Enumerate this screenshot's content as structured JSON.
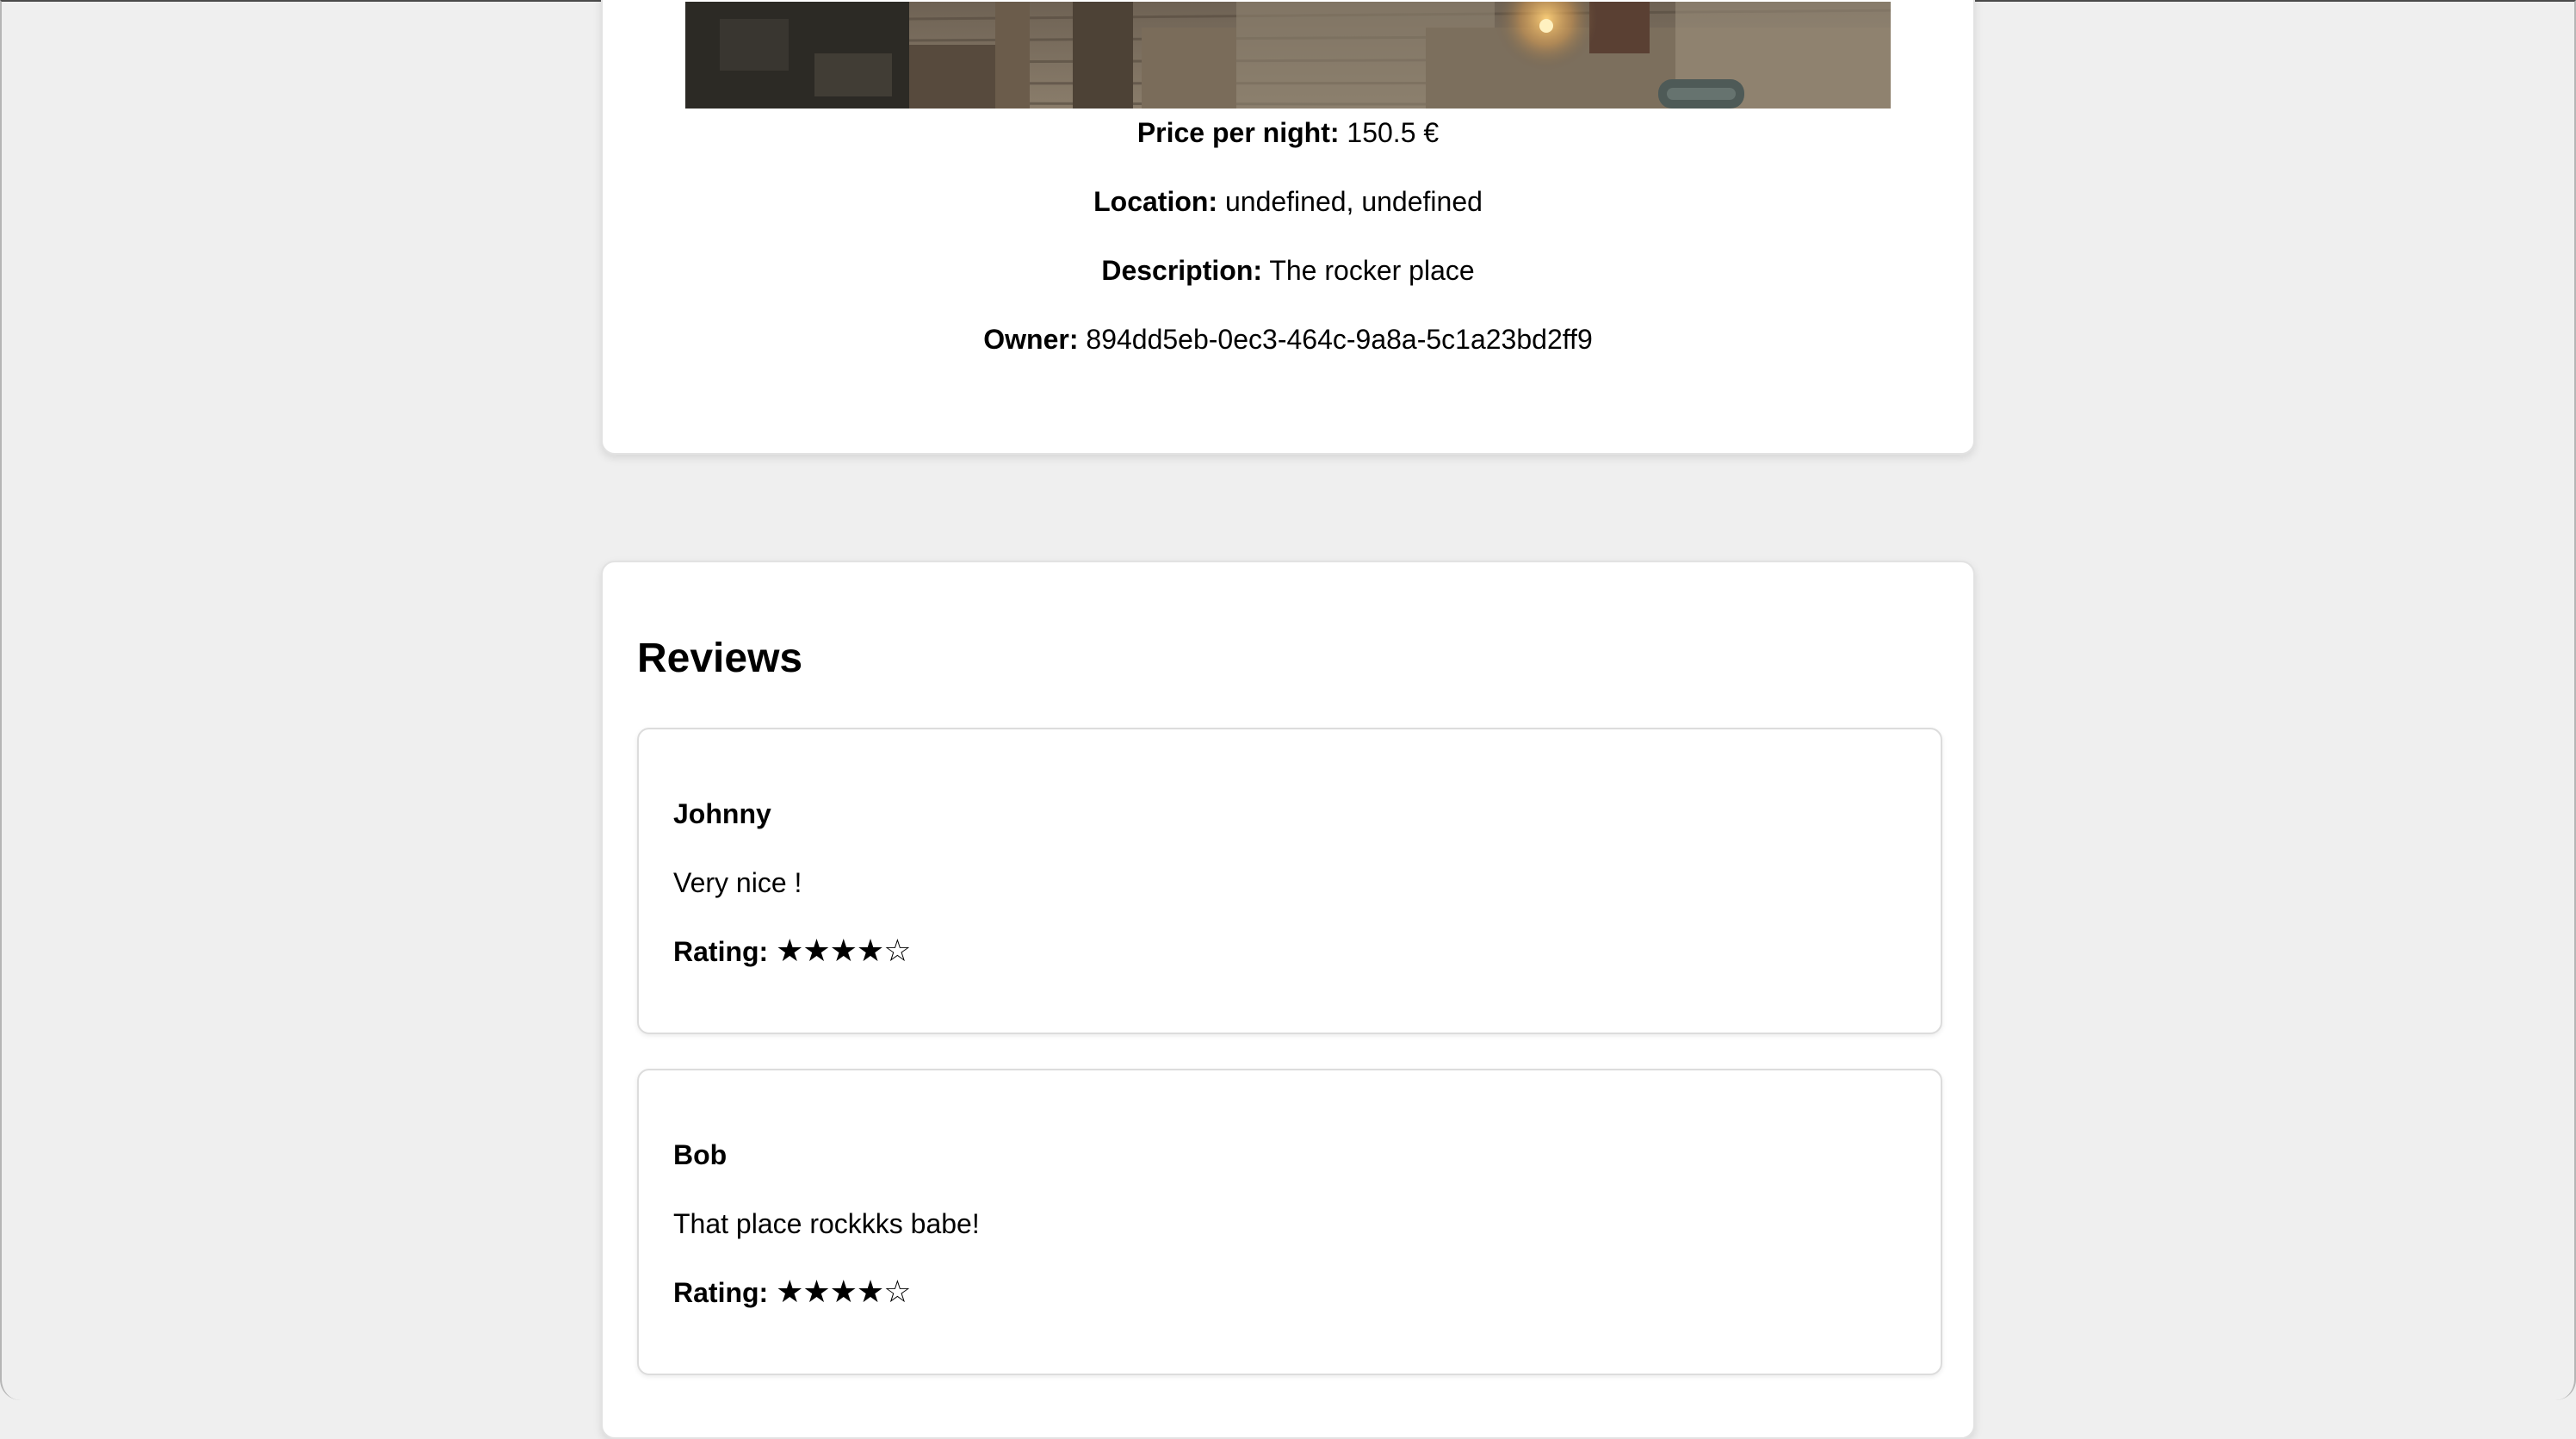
{
  "listing": {
    "photo_icon": "listing-photo",
    "price_label": "Price per night:",
    "price_value": "150.5 €",
    "location_label": "Location:",
    "location_value": "undefined, undefined",
    "description_label": "Description:",
    "description_value": "The rocker place",
    "owner_label": "Owner:",
    "owner_value": "894dd5eb-0ec3-464c-9a8a-5c1a23bd2ff9"
  },
  "reviews": {
    "heading": "Reviews",
    "rating_label": "Rating:",
    "items": [
      {
        "author": "Johnny",
        "text": "Very nice !",
        "rating": 4,
        "max_rating": 5,
        "stars": "★★★★☆"
      },
      {
        "author": "Bob",
        "text": "That place rockkks babe!",
        "rating": 4,
        "max_rating": 5,
        "stars": "★★★★☆"
      }
    ]
  },
  "colors": {
    "page_background": "#efefef",
    "card_background": "#ffffff",
    "card_border": "#e2e2e2",
    "text": "#000000"
  }
}
